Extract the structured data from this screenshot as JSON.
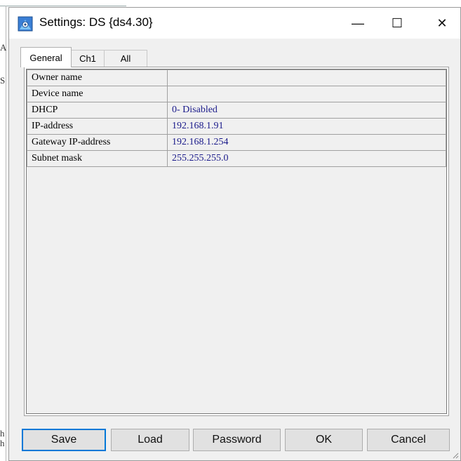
{
  "background_app": {
    "fragments": [
      "A",
      "S",
      "h",
      "h"
    ]
  },
  "window": {
    "title": "Settings: DS {ds4.30}",
    "app_icon": "settings-app-icon",
    "controls": {
      "minimize": "—",
      "maximize": "☐",
      "close": "✕"
    }
  },
  "tabs": [
    {
      "label": "General",
      "active": true
    },
    {
      "label": "Ch1",
      "active": false
    },
    {
      "label": "All",
      "active": false
    }
  ],
  "properties": [
    {
      "name": "Owner name",
      "value": ""
    },
    {
      "name": "Device name",
      "value": ""
    },
    {
      "name": "DHCP",
      "value": "0- Disabled"
    },
    {
      "name": "IP-address",
      "value": "192.168.1.91"
    },
    {
      "name": "Gateway IP-address",
      "value": "192.168.1.254"
    },
    {
      "name": "Subnet mask",
      "value": "255.255.255.0"
    }
  ],
  "buttons": {
    "save": "Save",
    "load": "Load",
    "password": "Password",
    "ok": "OK",
    "cancel": "Cancel"
  },
  "colors": {
    "value_text": "#1a1a8a",
    "default_button_border": "#0078d7"
  }
}
